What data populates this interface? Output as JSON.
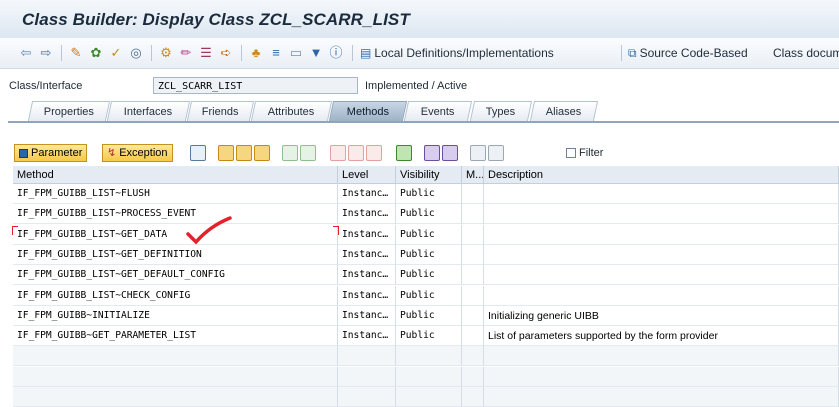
{
  "window": {
    "title": "Class Builder: Display Class ZCL_SCARR_LIST"
  },
  "toolbar": {
    "icons": [
      "back-arrow-icon",
      "forward-arrow-icon",
      "display-change-icon",
      "activate-icon",
      "check-icon",
      "object-list-icon",
      "hierarchy-icon",
      "where-used-icon",
      "find-icon",
      "mark-icon",
      "pattern-icon",
      "pretty-printer-icon",
      "select-icon",
      "filter-icon",
      "info-icon"
    ],
    "local_definitions_label": "Local Definitions/Implementations",
    "source_code_label": "Source Code-Based",
    "class_doc_label": "Class docume"
  },
  "header": {
    "class_label": "Class/Interface",
    "class_value": "ZCL_SCARR_LIST",
    "status": "Implemented / Active"
  },
  "tabs": [
    {
      "label": "Properties"
    },
    {
      "label": "Interfaces"
    },
    {
      "label": "Friends"
    },
    {
      "label": "Attributes"
    },
    {
      "label": "Methods"
    },
    {
      "label": "Events"
    },
    {
      "label": "Types"
    },
    {
      "label": "Aliases"
    }
  ],
  "active_tab": "Methods",
  "subtoolbar": {
    "parameter_label": "Parameter",
    "exception_label": "Exception",
    "filter_label": "Filter"
  },
  "table": {
    "columns": [
      "Method",
      "Level",
      "Visibility",
      "M...",
      "Description"
    ],
    "rows": [
      {
        "method": "IF_FPM_GUIBB_LIST~FLUSH",
        "level": "Instanc…",
        "visibility": "Public",
        "m": "",
        "description": ""
      },
      {
        "method": "IF_FPM_GUIBB_LIST~PROCESS_EVENT",
        "level": "Instanc…",
        "visibility": "Public",
        "m": "",
        "description": ""
      },
      {
        "method": "IF_FPM_GUIBB_LIST~GET_DATA",
        "level": "Instanc…",
        "visibility": "Public",
        "m": "",
        "description": ""
      },
      {
        "method": "IF_FPM_GUIBB_LIST~GET_DEFINITION",
        "level": "Instanc…",
        "visibility": "Public",
        "m": "",
        "description": ""
      },
      {
        "method": "IF_FPM_GUIBB_LIST~GET_DEFAULT_CONFIG",
        "level": "Instanc…",
        "visibility": "Public",
        "m": "",
        "description": ""
      },
      {
        "method": "IF_FPM_GUIBB_LIST~CHECK_CONFIG",
        "level": "Instanc…",
        "visibility": "Public",
        "m": "",
        "description": ""
      },
      {
        "method": "IF_FPM_GUIBB~INITIALIZE",
        "level": "Instanc…",
        "visibility": "Public",
        "m": "",
        "description": "Initializing generic UIBB"
      },
      {
        "method": "IF_FPM_GUIBB~GET_PARAMETER_LIST",
        "level": "Instanc…",
        "visibility": "Public",
        "m": "",
        "description": "List of parameters supported by the form provider"
      }
    ]
  },
  "colors": {
    "accent": "#e2232b",
    "tab_active": "#9eb3c8",
    "pressed": "#f7c84a"
  }
}
